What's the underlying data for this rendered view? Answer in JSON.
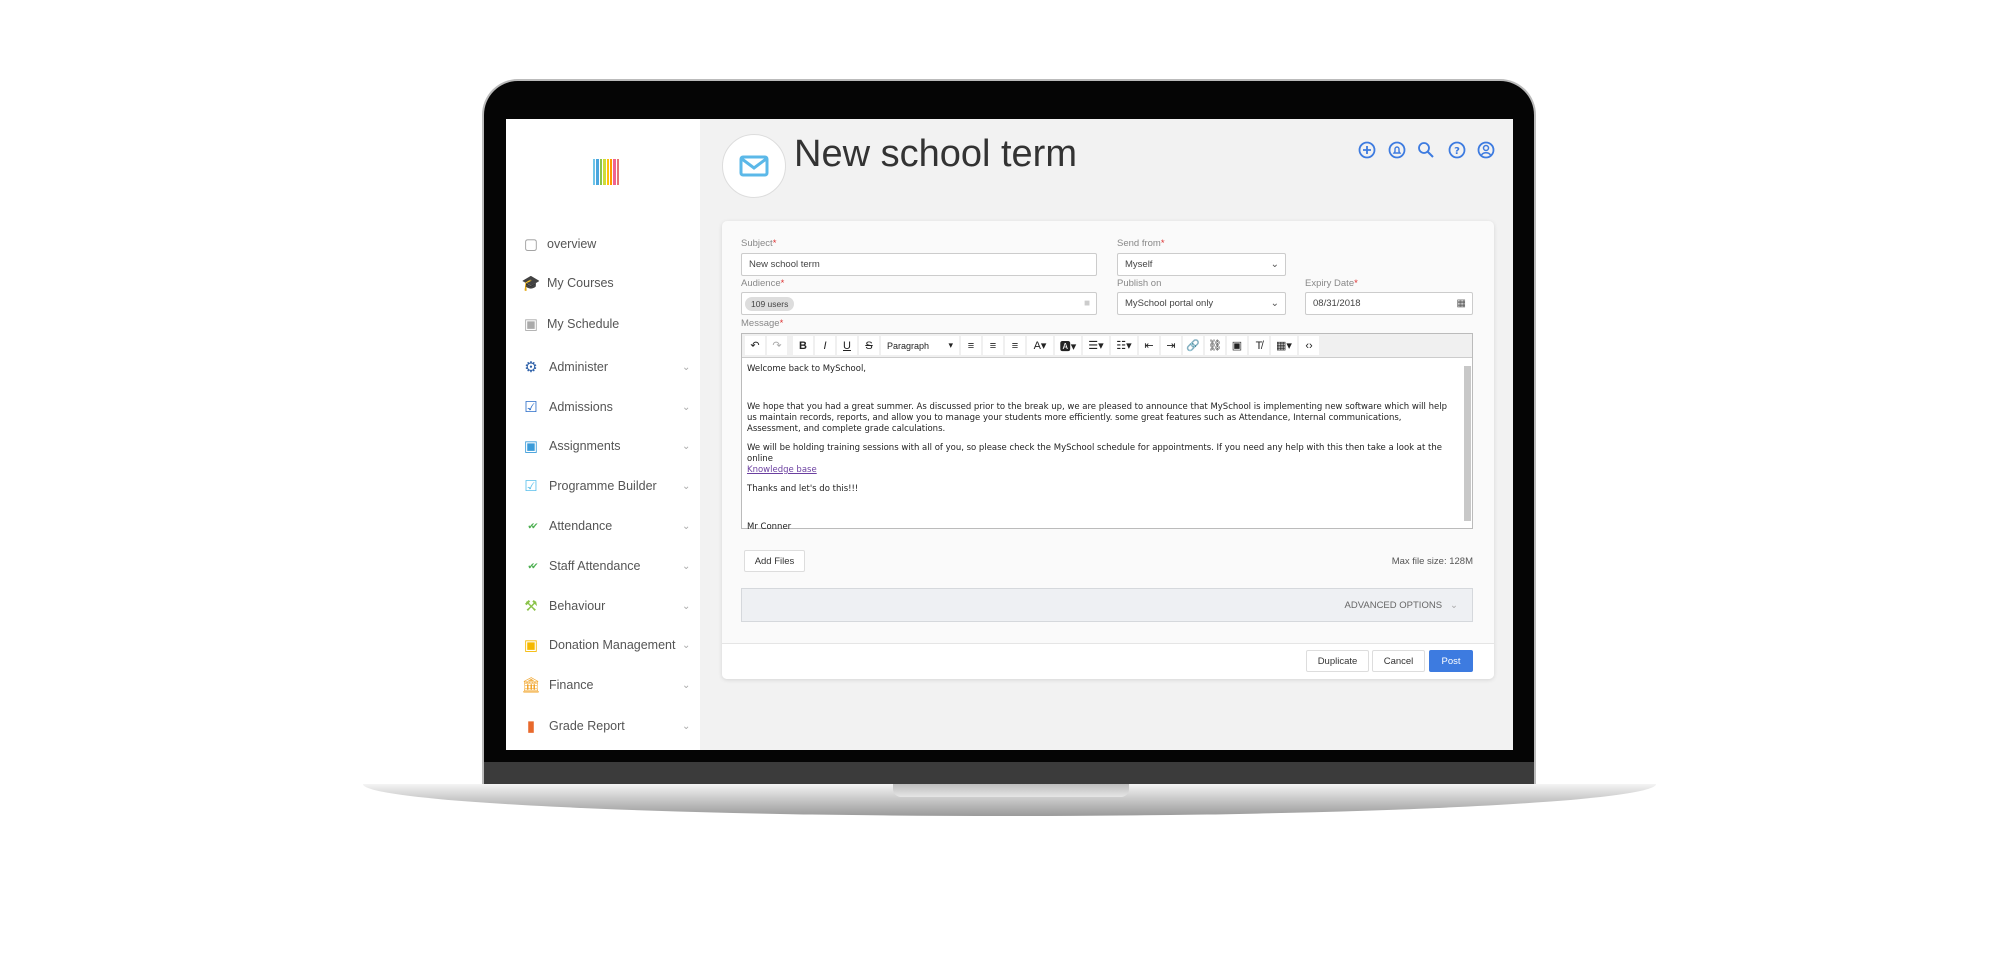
{
  "colors": {
    "accent": "#3d7be0",
    "post_button": "#3d7be0",
    "required": "#d33"
  },
  "sidebar": {
    "logo_colors": [
      "#6fc5e8",
      "#4aa6de",
      "#8bc34a",
      "#cddc39",
      "#ffc107",
      "#ff9800",
      "#f06292",
      "#e57373"
    ],
    "items": [
      {
        "label": "overview",
        "icon": "square-icon",
        "color": "#999"
      },
      {
        "label": "My Courses",
        "icon": "graduation-cap-icon",
        "color": "#aaa"
      },
      {
        "label": "My Schedule",
        "icon": "calendar-icon",
        "color": "#aaa"
      },
      {
        "label": "Administer",
        "icon": "gear-icon",
        "color": "#2c5fa8",
        "chevron": true
      },
      {
        "label": "Admissions",
        "icon": "clipboard-check-icon",
        "color": "#2c6ec9",
        "chevron": true
      },
      {
        "label": "Assignments",
        "icon": "badge-icon",
        "color": "#3a9bd9",
        "chevron": true
      },
      {
        "label": "Programme Builder",
        "icon": "clipboard-check-icon",
        "color": "#5bc0eb",
        "chevron": true
      },
      {
        "label": "Attendance",
        "icon": "double-check-icon",
        "color": "#4caf50",
        "chevron": true
      },
      {
        "label": "Staff Attendance",
        "icon": "double-check-icon",
        "color": "#4caf50",
        "chevron": true
      },
      {
        "label": "Behaviour",
        "icon": "gavel-icon",
        "color": "#8bc34a",
        "chevron": true
      },
      {
        "label": "Donation Management",
        "icon": "wallet-icon",
        "color": "#f5b800",
        "chevron": true
      },
      {
        "label": "Finance",
        "icon": "bank-icon",
        "color": "#f0a020",
        "chevron": true
      },
      {
        "label": "Grade Report",
        "icon": "bookmark-icon",
        "color": "#e8692c",
        "chevron": true
      }
    ]
  },
  "header": {
    "title": "New school term",
    "icon": "envelope-icon",
    "actions": [
      "plus-circle-icon",
      "bell-icon",
      "search-icon",
      "help-icon",
      "user-icon"
    ]
  },
  "form": {
    "subject_label": "Subject",
    "subject_value": "New school term",
    "send_from_label": "Send from",
    "send_from_value": "Myself",
    "audience_label": "Audience",
    "audience_chip": "109 users",
    "publish_label": "Publish on",
    "publish_value": "MySchool portal only",
    "expiry_label": "Expiry Date",
    "expiry_value": "08/31/2018",
    "message_label": "Message",
    "required_mark": "*",
    "format_value": "Paragraph",
    "message": {
      "p1": "Welcome back to MySchool,",
      "p2": "We hope that you had a great summer. As discussed prior to the break up, we are pleased to announce that MySchool is implementing new software which will help us maintain records, reports, and allow you to manage your students more efficiently. some great features such as Attendance, Internal communications, Assessment, and complete grade calculations.",
      "p3": "We will be holding training sessions with all of you, so please check the MySchool schedule for appointments. If you need any help with this then take a look at the online",
      "link": "Knowledge base",
      "p4": "Thanks and let's do this!!!",
      "p5": "Mr Conner"
    },
    "add_files": "Add Files",
    "max_file_size": "Max file size: 128M",
    "advanced": "ADVANCED OPTIONS",
    "duplicate": "Duplicate",
    "cancel": "Cancel",
    "post": "Post"
  }
}
